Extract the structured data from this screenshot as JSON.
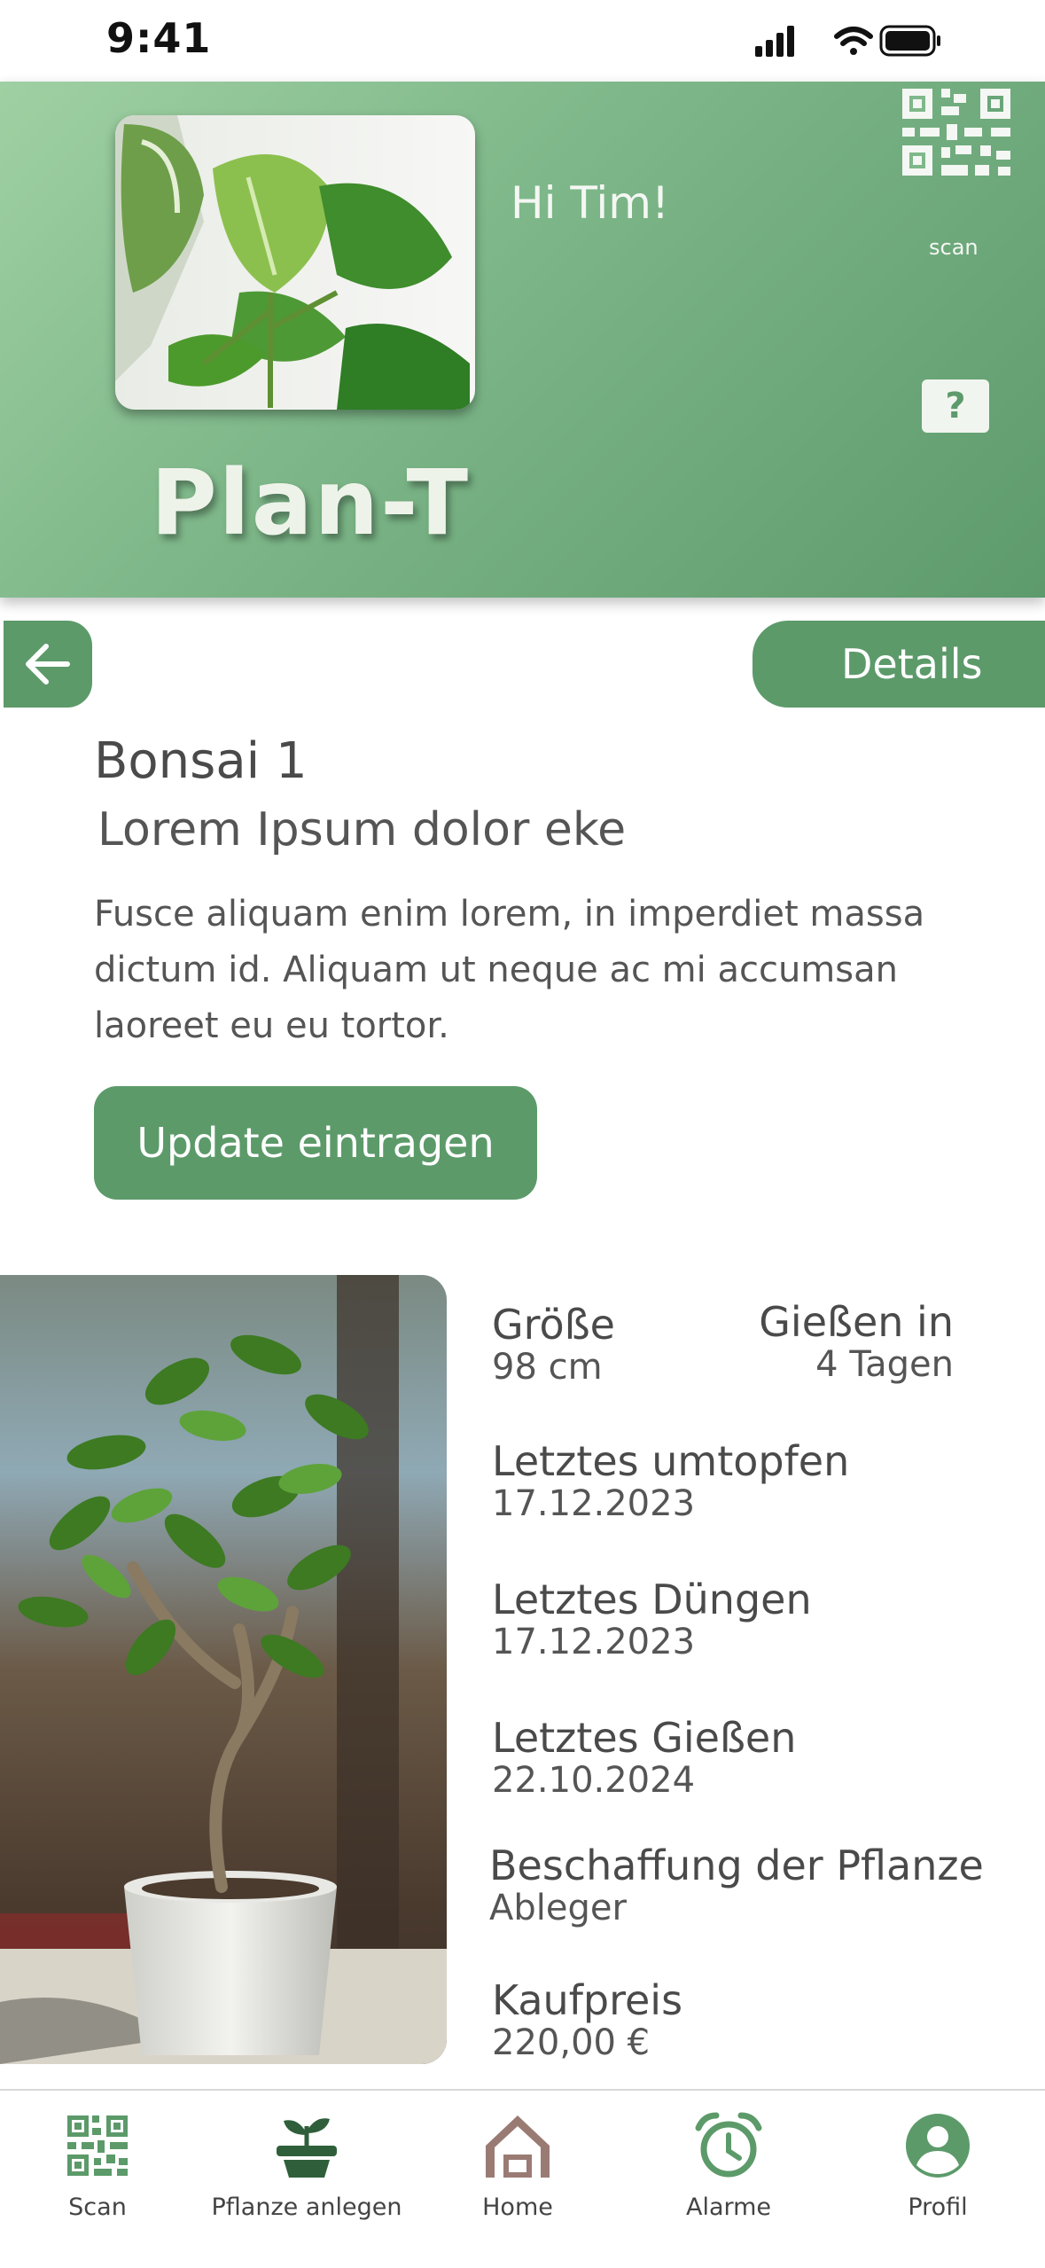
{
  "status_bar": {
    "time": "9:41"
  },
  "header": {
    "greeting": "Hi Tim!",
    "brand": "Plan-T",
    "scan_label": "scan",
    "help_symbol": "?",
    "accent": "#6aa678"
  },
  "actions": {
    "details_label": "Details"
  },
  "plant": {
    "name": "Bonsai 1",
    "subtitle": "Lorem Ipsum dolor eke",
    "description": "Fusce aliquam enim lorem, in imperdiet massa dictum id. Aliquam ut neque ac mi accumsan laoreet eu eu tortor.",
    "update_label": "Update eintragen"
  },
  "details": {
    "size_label": "Größe",
    "size_value": "98 cm",
    "water_in_label": "Gießen in",
    "water_in_value": "4 Tagen",
    "repot_label": "Letztes umtopfen",
    "repot_value": "17.12.2023",
    "fertilize_label": "Letztes Düngen",
    "fertilize_value": "17.12.2023",
    "watered_label": "Letztes Gießen",
    "watered_value": "22.10.2024",
    "source_label": "Beschaffung der Pflanze",
    "source_value": "Ableger",
    "price_label": "Kaufpreis",
    "price_value": "220,00 €"
  },
  "nav": {
    "items": [
      {
        "label": "Scan",
        "icon": "qr-icon"
      },
      {
        "label": "Pflanze anlegen",
        "icon": "plant-pot-icon"
      },
      {
        "label": "Home",
        "icon": "home-icon"
      },
      {
        "label": "Alarme",
        "icon": "alarm-icon"
      },
      {
        "label": "Profil",
        "icon": "profile-icon"
      }
    ]
  },
  "colors": {
    "primary": "#5c9a6a",
    "header_light": "#9fd0a3",
    "header_dark": "#5d9a6c"
  }
}
